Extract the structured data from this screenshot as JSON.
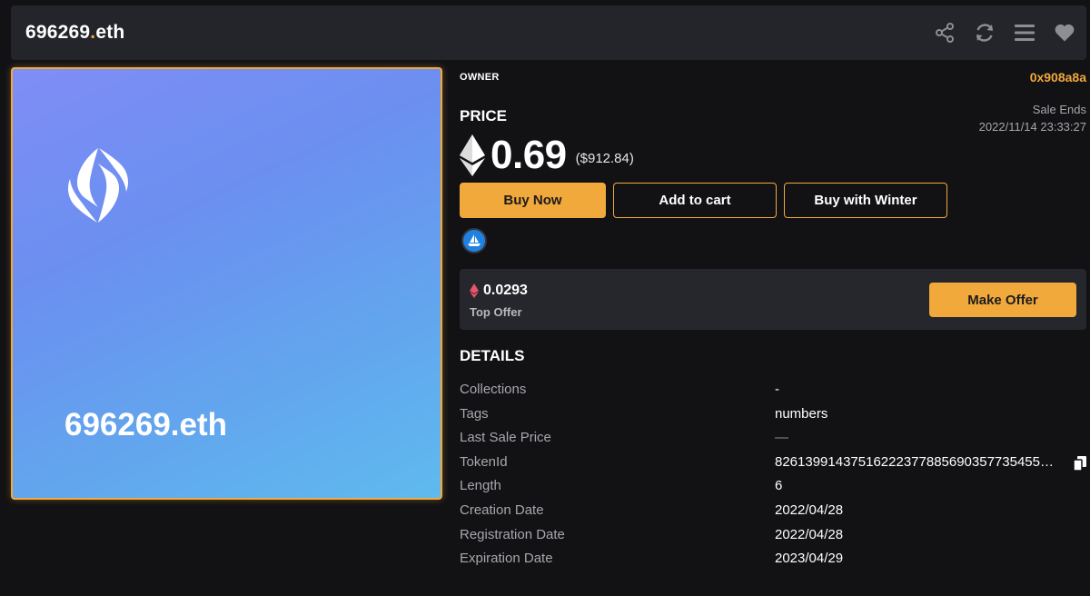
{
  "header": {
    "title_main": "696269",
    "title_dot": ".",
    "title_tld": "eth",
    "icons": [
      "share-icon",
      "refresh-icon",
      "menu-icon",
      "heart-icon"
    ]
  },
  "nft": {
    "name": "696269.eth",
    "logo": "ens-logo",
    "colors": {
      "gradient_start": "#7f8ef6",
      "gradient_end": "#5fbaee",
      "border": "#f2a93b"
    }
  },
  "owner": {
    "label": "OWNER",
    "address": "0x908a8a"
  },
  "price": {
    "label": "PRICE",
    "value": "0.69",
    "usd": "($912.84)",
    "sale_ends_label": "Sale Ends",
    "sale_ends_date": "2022/11/14 23:33:27"
  },
  "buttons": {
    "buy_now": "Buy Now",
    "add_to_cart": "Add to cart",
    "buy_winter": "Buy with Winter",
    "make_offer": "Make Offer"
  },
  "marketplace_icon": "opensea-icon",
  "offer": {
    "value": "0.0293",
    "label": "Top Offer"
  },
  "details": {
    "title": "DETAILS",
    "rows": [
      {
        "label": "Collections",
        "value": "-"
      },
      {
        "label": "Tags",
        "value": "numbers"
      },
      {
        "label": "Last Sale Price",
        "value": "—"
      },
      {
        "label": "TokenId",
        "value": "82613991437516222377885690357735455…"
      },
      {
        "label": "Length",
        "value": "6"
      },
      {
        "label": "Creation Date",
        "value": "2022/04/28"
      },
      {
        "label": "Registration Date",
        "value": "2022/04/28"
      },
      {
        "label": "Expiration Date",
        "value": "2023/04/29"
      }
    ]
  },
  "colors": {
    "accent": "#f2a93b",
    "background": "#121215",
    "panel": "#24252b"
  }
}
